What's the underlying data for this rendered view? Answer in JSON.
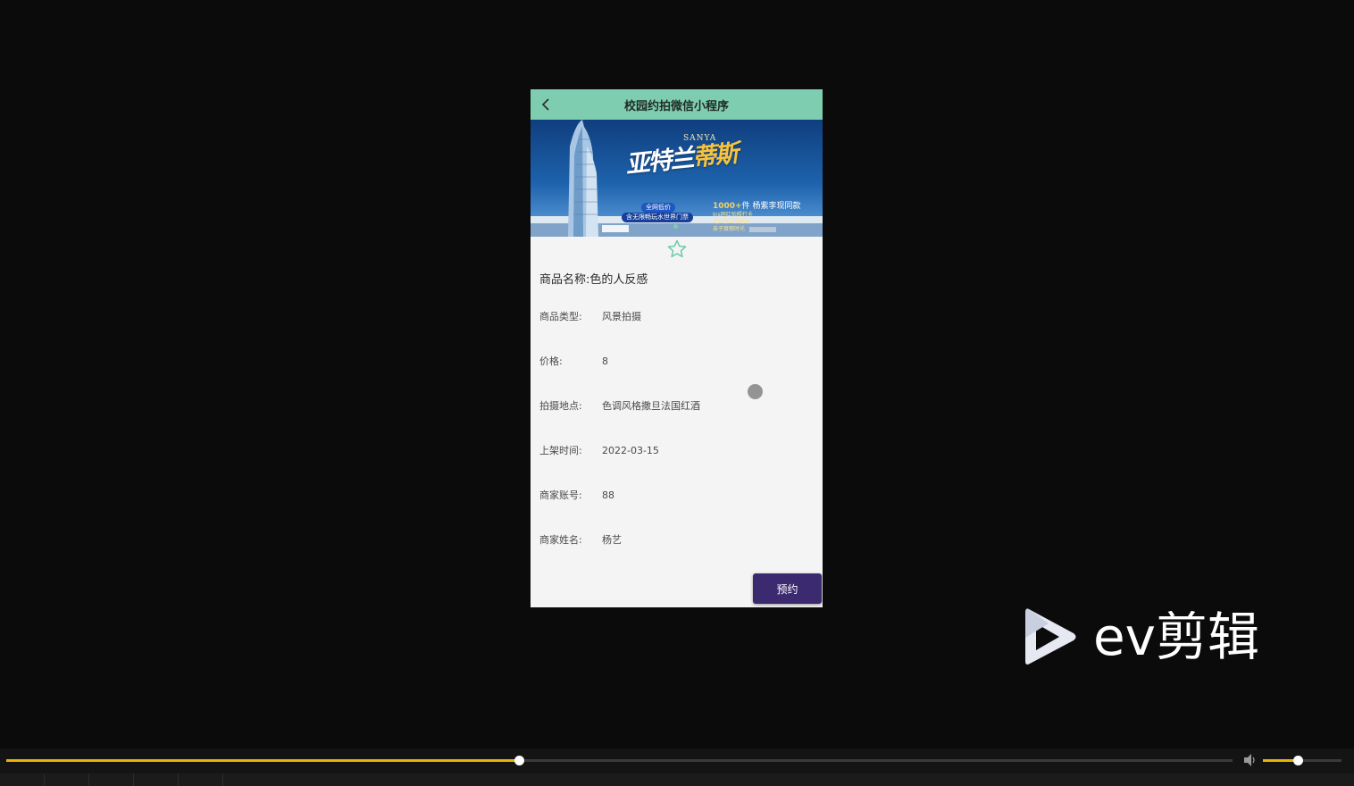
{
  "app": {
    "nav_title": "校园约拍微信小程序"
  },
  "banner": {
    "slogan_en": "SANYA",
    "slogan_white": "亚特兰",
    "slogan_gold": "蒂斯",
    "pill_1": "全网低价",
    "pill_2": "含无限畅玩水世界门票",
    "promo_num": "1000+",
    "promo_text": "件 杨紫李现同款",
    "sub_1": "Ins网红拍照打卡",
    "sub_2": "网红水世界畅玩",
    "sub_3": "亲子度假时光"
  },
  "product": {
    "name_label": "商品名称:",
    "name_value": "色的人反感",
    "fields": [
      {
        "label": "商品类型:",
        "value": "风景拍摄"
      },
      {
        "label": "价格:",
        "value": "8"
      },
      {
        "label": "拍摄地点:",
        "value": "色调风格撒旦法国红酒"
      },
      {
        "label": "上架时间:",
        "value": "2022-03-15"
      },
      {
        "label": "商家账号:",
        "value": "88"
      },
      {
        "label": "商家姓名:",
        "value": "杨艺"
      }
    ],
    "book_label": "预约"
  },
  "watermark": {
    "brand": "ev剪辑"
  },
  "player": {
    "progress": 0.418,
    "volume": 0.44,
    "accent": "#e8b400"
  },
  "colors": {
    "nav_bg": "#7ecdb1",
    "book_bg": "#3c2a70"
  }
}
